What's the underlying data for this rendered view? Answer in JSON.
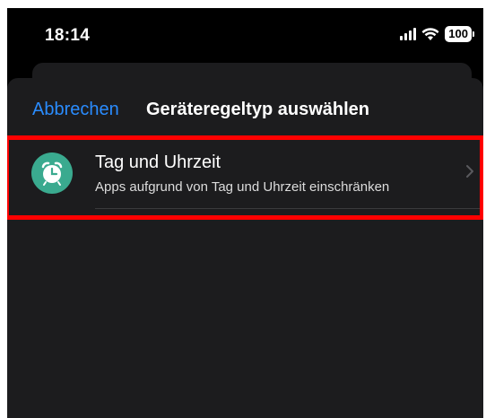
{
  "status_bar": {
    "time": "18:14",
    "battery": "100"
  },
  "nav": {
    "cancel_label": "Abbrechen",
    "title": "Geräteregeltyp auswählen"
  },
  "list": {
    "items": [
      {
        "title": "Tag und Uhrzeit",
        "subtitle": "Apps aufgrund von Tag und Uhrzeit einschränken",
        "icon": "alarm-clock-icon"
      }
    ]
  },
  "colors": {
    "accent": "#2a8cff",
    "icon_bg": "#3aaa8f",
    "highlight": "#ff0000"
  }
}
